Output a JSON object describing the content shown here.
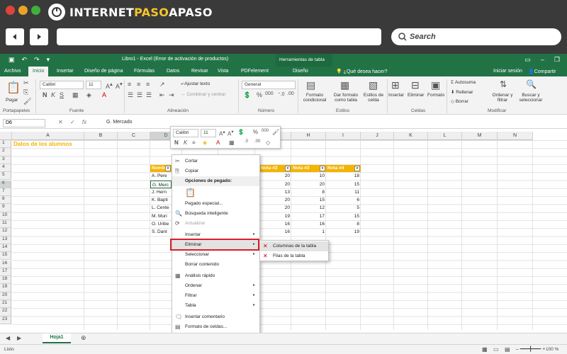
{
  "browser": {
    "logo_prefix": "INTERNET",
    "logo_accent": "PASO",
    "logo_suffix": "APASO",
    "search_label": "Search",
    "dot_colors": [
      "#e0433a",
      "#e8a329",
      "#3fae3a"
    ]
  },
  "excel": {
    "doc_title": "Libro1 - Excel (Error de activación de productos)",
    "tools_context": "Herramientas de tabla",
    "tabs": [
      "Archivo",
      "Inicio",
      "Insertar",
      "Diseño de página",
      "Fórmulas",
      "Datos",
      "Revisar",
      "Vista",
      "PDFelement",
      "Diseño"
    ],
    "active_tab": "Inicio",
    "tell_me": "¿Qué desea hacer?",
    "sign_in": "Iniciar sesión",
    "share": "Compartir",
    "ribbon": {
      "paste": "Pegar",
      "font_name": "Calibri",
      "font_size": "11",
      "wrap_text": "Ajustar texto",
      "merge_center": "Combinar y centrar",
      "number_format": "General",
      "conditional_format": "Formato condicional",
      "format_table": "Dar formato como tabla",
      "cell_styles": "Estilos de celda",
      "insert": "Insertar",
      "delete": "Eliminar",
      "format": "Formato",
      "autosum": "Autosuma",
      "fill": "Rellenar",
      "clear": "Borrar",
      "sort_filter": "Ordenar y filtrar",
      "find_select": "Buscar y seleccionar",
      "groups": [
        "Portapapeles",
        "Fuente",
        "Alineación",
        "Número",
        "Estilos",
        "Celdas",
        "Modificar"
      ]
    },
    "name_box": "D6",
    "formula": "G. Mercado",
    "columns": [
      "A",
      "B",
      "C",
      "D",
      "E",
      "F",
      "G",
      "H",
      "I",
      "J",
      "K",
      "L",
      "M",
      "N"
    ],
    "rows": [
      "1",
      "2",
      "3",
      "4",
      "5",
      "6",
      "7",
      "8",
      "9",
      "10",
      "11",
      "12",
      "13",
      "14",
      "15",
      "16",
      "17",
      "18",
      "19",
      "20",
      "21",
      "22",
      "23"
    ],
    "sheet_title": "Datos de los alumnos",
    "table_headers": [
      "Nombre",
      "Nota #2",
      "Nota #3",
      "Nota #4"
    ],
    "names": [
      "A. Pere",
      "G. Merc",
      "J. Hern",
      "K. Bapti",
      "L. Cente",
      "M. Muri",
      "O. Uribe",
      "S. Dant"
    ],
    "nota2": [
      "20",
      "20",
      "13",
      "20",
      "20",
      "19",
      "16",
      "16"
    ],
    "nota3": [
      "10",
      "20",
      "8",
      "15",
      "12",
      "17",
      "16",
      "1"
    ],
    "nota4": [
      "18",
      "15",
      "11",
      "6",
      "5",
      "15",
      "8",
      "19"
    ],
    "mini_toolbar": {
      "font_name": "Calibri",
      "font_size": "11"
    },
    "context_menu": [
      {
        "label": "Cortar",
        "icon": "scissors-icon",
        "glyph": "✂"
      },
      {
        "label": "Copiar",
        "icon": "copy-icon",
        "glyph": "⎘"
      },
      {
        "label": "Opciones de pegado:",
        "header": true
      },
      {
        "label": "",
        "icon": "paste-icon",
        "glyph": "📋"
      },
      {
        "label": "Pegado especial...",
        "glyph": ""
      },
      {
        "label": "Búsqueda inteligente",
        "icon": "smart-lookup-icon",
        "glyph": "🔍"
      },
      {
        "label": "Actualizar",
        "icon": "refresh-icon",
        "glyph": "⟳",
        "disabled": true
      },
      {
        "label": "Insertar",
        "submenu": true
      },
      {
        "label": "Eliminar",
        "submenu": true,
        "highlighted": true
      },
      {
        "label": "Seleccionar",
        "submenu": true
      },
      {
        "label": "Borrar contenido"
      },
      {
        "label": "Análisis rápido",
        "icon": "quick-analysis-icon",
        "glyph": "▦"
      },
      {
        "label": "Ordenar",
        "submenu": true
      },
      {
        "label": "Filtrar",
        "submenu": true
      },
      {
        "label": "Tabla",
        "submenu": true
      },
      {
        "label": "Insertar comentario",
        "icon": "comment-icon",
        "glyph": "🗨"
      },
      {
        "label": "Formato de celdas...",
        "icon": "format-cells-icon",
        "glyph": "▤"
      },
      {
        "label": "Elegir de la lista desplegable..."
      },
      {
        "label": "Hipervínculo...",
        "icon": "link-icon",
        "glyph": "🔗"
      }
    ],
    "submenu": [
      "Columnas de la tabla",
      "Filas de la tabla"
    ],
    "sheet_tab": "Hoja1",
    "status_left": "Listo",
    "zoom": "100 %",
    "colors": {
      "excel_green": "#217346",
      "header_yellow": "#f4b400",
      "title_orange": "#f4b400",
      "highlight_red": "#d9202a"
    }
  }
}
